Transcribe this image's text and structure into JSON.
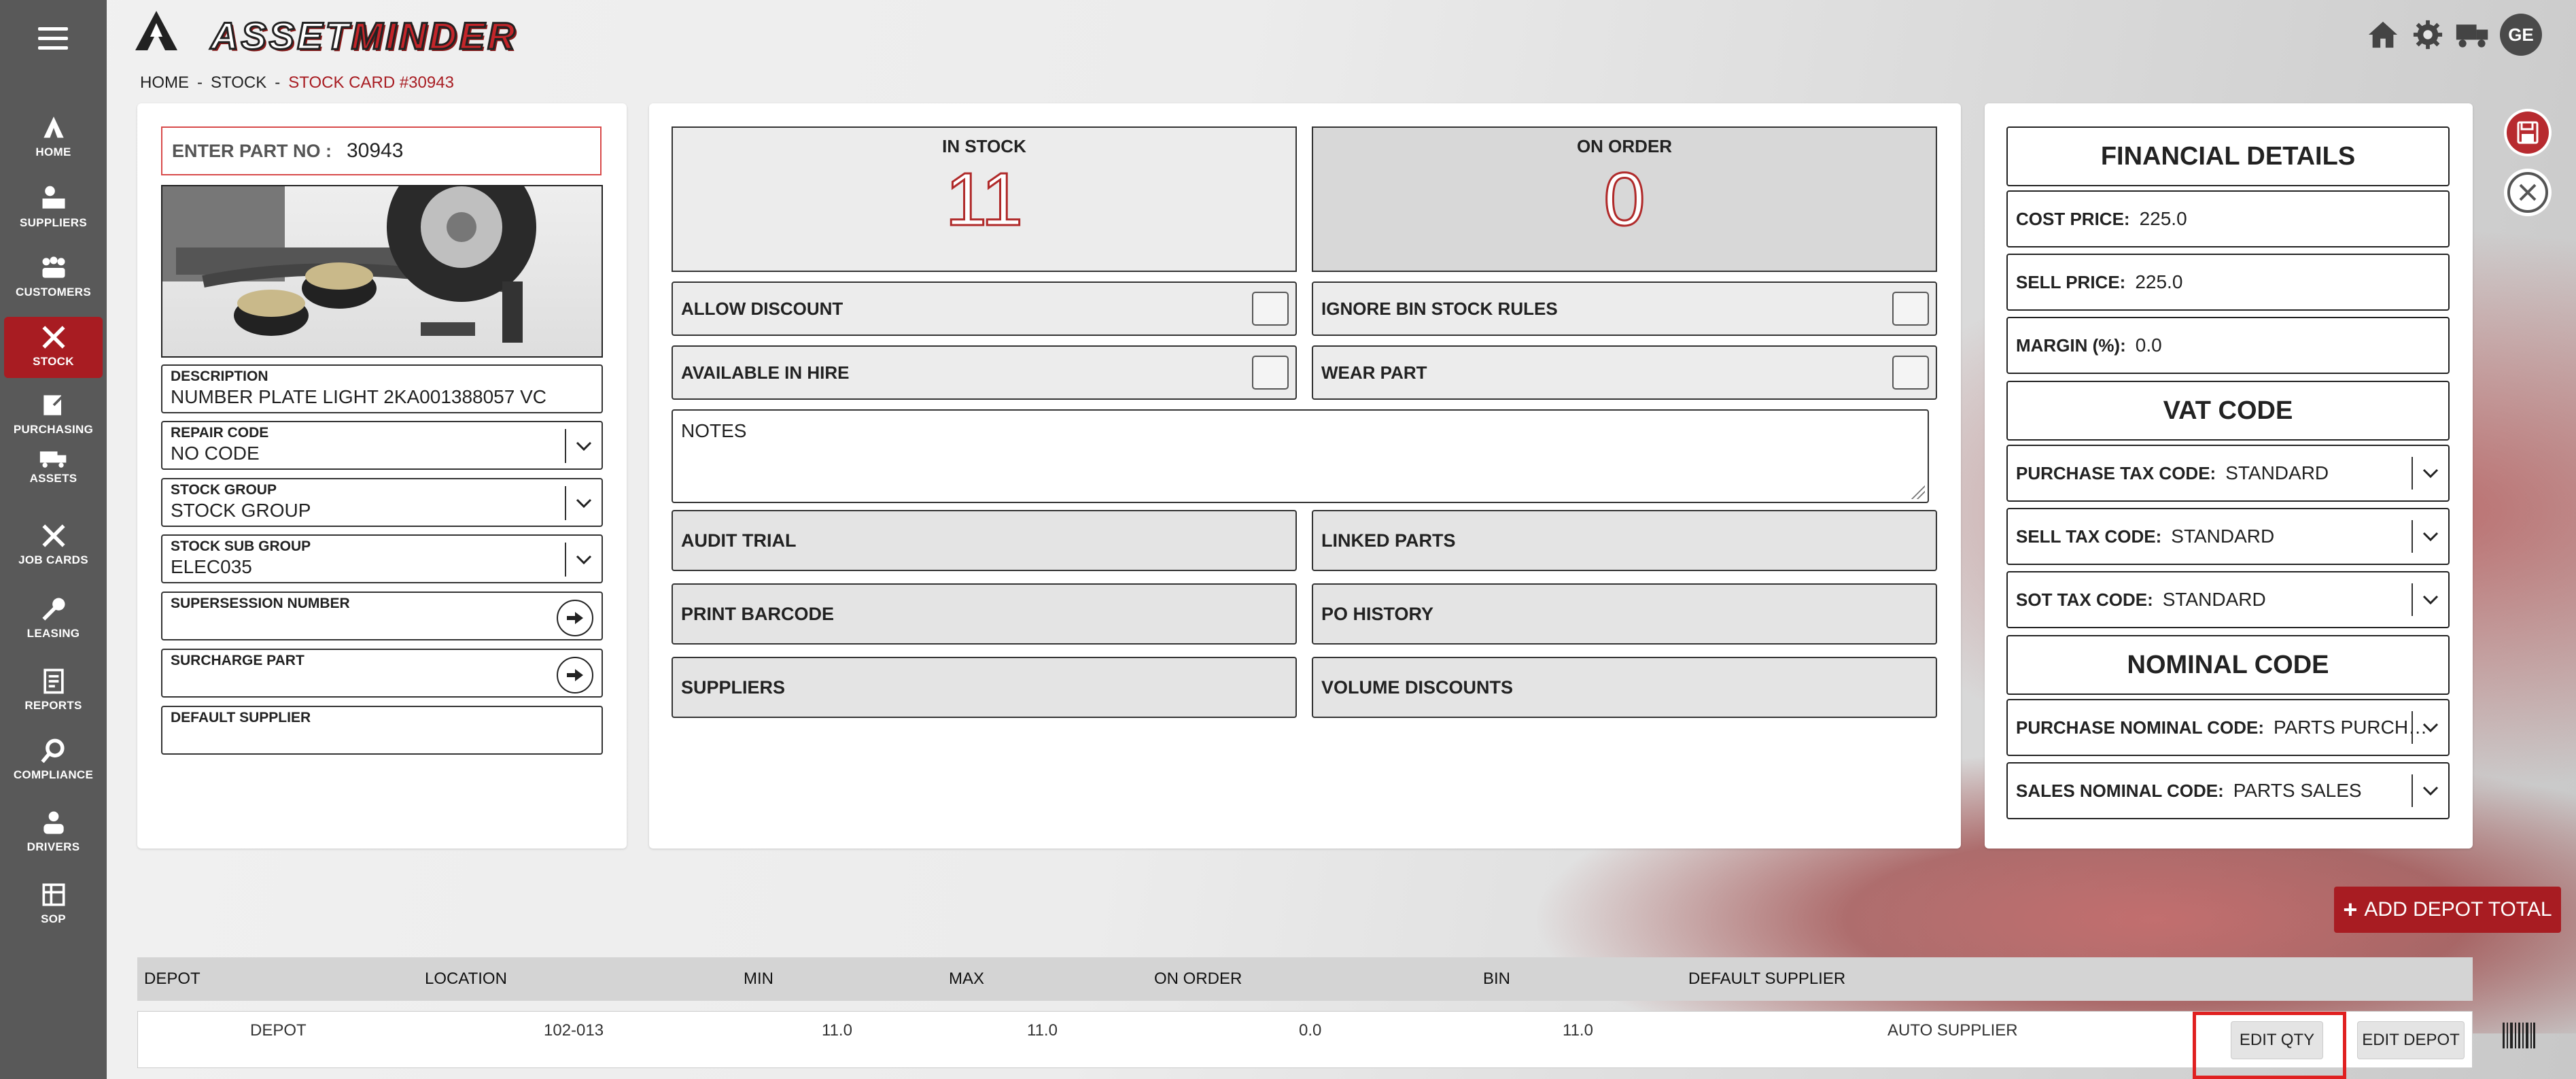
{
  "app": {
    "logo_part1": "ASSET",
    "logo_part2": "MINDER"
  },
  "sidebar": {
    "items": [
      {
        "label": "HOME",
        "icon": "home-icon"
      },
      {
        "label": "SUPPLIERS",
        "icon": "suppliers-icon"
      },
      {
        "label": "CUSTOMERS",
        "icon": "customers-icon"
      },
      {
        "label": "STOCK",
        "icon": "stock-icon"
      },
      {
        "label": "PURCHASING",
        "icon": "purchasing-icon"
      },
      {
        "label": "ASSETS",
        "icon": "truck-icon"
      },
      {
        "label": "JOB CARDS",
        "icon": "tools-icon"
      },
      {
        "label": "LEASING",
        "icon": "key-icon"
      },
      {
        "label": "REPORTS",
        "icon": "report-icon"
      },
      {
        "label": "COMPLIANCE",
        "icon": "magnifier-icon"
      },
      {
        "label": "DRIVERS",
        "icon": "driver-icon"
      },
      {
        "label": "SOP",
        "icon": "sop-icon"
      }
    ],
    "active_color": "#a81c22"
  },
  "header": {
    "avatar_initials": "GE"
  },
  "breadcrumb": {
    "home": "HOME",
    "stock": "STOCK",
    "current": "STOCK CARD #30943"
  },
  "part": {
    "enter_part_label": "ENTER PART NO :",
    "part_no": "30943",
    "description_label": "DESCRIPTION",
    "description": "NUMBER PLATE LIGHT 2KA001388057 VC",
    "repair_code_label": "REPAIR CODE",
    "repair_code": "NO CODE",
    "stock_group_label": "STOCK GROUP",
    "stock_group": "STOCK GROUP",
    "stock_sub_group_label": "STOCK SUB GROUP",
    "stock_sub_group": "ELEC035",
    "supersession_label": "SUPERSESSION NUMBER",
    "surcharge_label": "SURCHARGE PART",
    "default_supplier_label": "DEFAULT SUPPLIER"
  },
  "stock": {
    "in_stock_label": "IN STOCK",
    "in_stock": "11",
    "on_order_label": "ON ORDER",
    "on_order": "0",
    "allow_discount": "ALLOW DISCOUNT",
    "ignore_bin": "IGNORE BIN STOCK RULES",
    "available_hire": "AVAILABLE IN HIRE",
    "wear_part": "WEAR PART",
    "notes_label": "NOTES",
    "audit_trial": "AUDIT TRIAL",
    "linked_parts": "LINKED PARTS",
    "print_barcode": "PRINT BARCODE",
    "po_history": "PO HISTORY",
    "suppliers": "SUPPLIERS",
    "volume_discounts": "VOLUME DISCOUNTS"
  },
  "financial": {
    "title": "FINANCIAL DETAILS",
    "cost_label": "COST PRICE:",
    "cost": "225.0",
    "sell_label": "SELL PRICE:",
    "sell": "225.0",
    "margin_label": "MARGIN (%):",
    "margin": "0.0",
    "vat_title": "VAT CODE",
    "purchase_tax_label": "PURCHASE TAX CODE:",
    "purchase_tax": "STANDARD",
    "sell_tax_label": "SELL TAX CODE:",
    "sell_tax": "STANDARD",
    "sot_tax_label": "SOT TAX CODE:",
    "sot_tax": "STANDARD",
    "nominal_title": "NOMINAL CODE",
    "purchase_nominal_label": "PURCHASE NOMINAL CODE:",
    "purchase_nominal": "PARTS PURCHA...",
    "sales_nominal_label": "SALES NOMINAL CODE:",
    "sales_nominal": "PARTS SALES"
  },
  "actions": {
    "add_depot_total": "ADD DEPOT TOTAL"
  },
  "depot_table": {
    "headers": [
      "DEPOT",
      "LOCATION",
      "MIN",
      "MAX",
      "ON ORDER",
      "BIN",
      "DEFAULT SUPPLIER"
    ],
    "rows": [
      [
        "DEPOT",
        "102-013",
        "11.0",
        "11.0",
        "0.0",
        "11.0",
        "AUTO SUPPLIER"
      ]
    ],
    "edit_qty": "EDIT QTY",
    "edit_depot": "EDIT DEPOT"
  }
}
